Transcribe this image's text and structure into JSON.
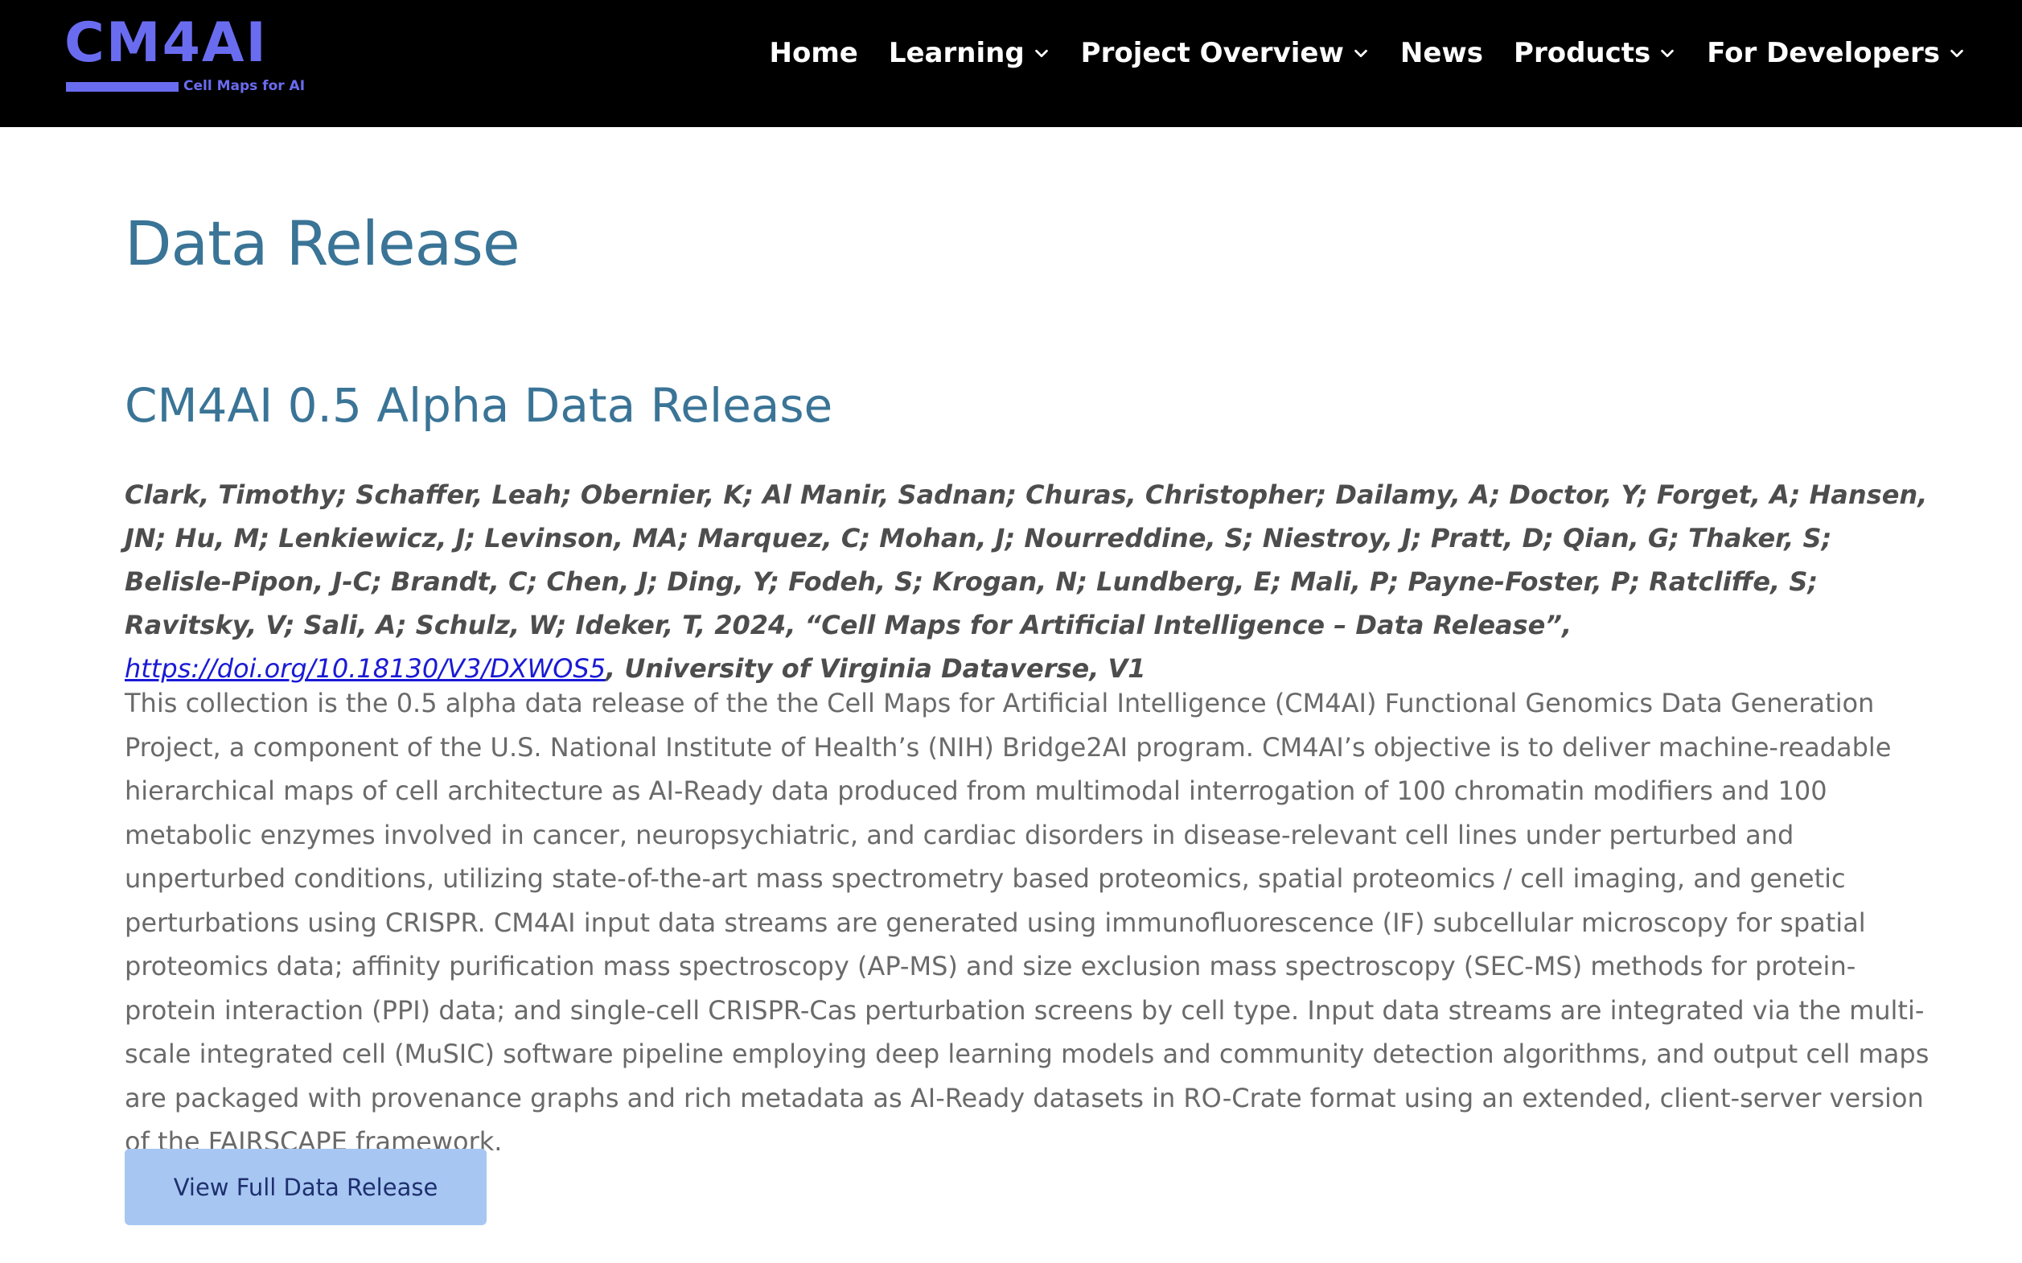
{
  "header": {
    "logo_text": "CM4AI",
    "logo_subtitle": "Cell Maps for AI",
    "brand_color": "#6a6cf0",
    "nav": [
      {
        "label": "Home",
        "has_dropdown": false
      },
      {
        "label": "Learning",
        "has_dropdown": true
      },
      {
        "label": "Project Overview",
        "has_dropdown": true
      },
      {
        "label": "News",
        "has_dropdown": false
      },
      {
        "label": "Products",
        "has_dropdown": true
      },
      {
        "label": "For Developers",
        "has_dropdown": true
      }
    ]
  },
  "main": {
    "page_title": "Data Release",
    "section_title": "CM4AI 0.5 Alpha Data Release",
    "citation": {
      "authors_text": "Clark, Timothy; Schaffer, Leah; Obernier, K; Al Manir, Sadnan; Churas, Christopher; Dailamy, A; Doctor, Y; Forget, A; Hansen, JN; Hu, M; Lenkiewicz, J; Levinson, MA; Marquez, C; Mohan, J; Nourreddine, S; Niestroy, J; Pratt, D; Qian, G; Thaker, S; Belisle-Pipon, J-C; Brandt, C; Chen, J; Ding, Y; Fodeh, S; Krogan, N; Lundberg, E; Mali, P; Payne-Foster, P; Ratcliffe, S; Ravitsky, V; Sali, A; Schulz, W; Ideker, T, 2024, “Cell Maps for Artificial Intelligence – Data Release”, ",
      "doi_link": "https://doi.org/10.18130/V3/DXWOS5",
      "suffix": ", University of Virginia Dataverse, V1"
    },
    "description": "This collection is the 0.5 alpha data release of the the Cell Maps for Artificial Intelligence (CM4AI) Functional Genomics Data Generation Project, a component of the U.S. National Institute of Health’s (NIH) Bridge2AI program. CM4AI’s objective is to deliver machine-readable hierarchical maps of cell architecture as AI-Ready data produced from multimodal interrogation of 100 chromatin modifiers and 100 metabolic enzymes involved in cancer, neuropsychiatric, and cardiac disorders in disease-relevant cell lines under perturbed and unperturbed conditions, utilizing state-of-the-art mass spectrometry based proteomics, spatial proteomics / cell imaging, and genetic perturbations using CRISPR. CM4AI input data streams are generated using immunofluorescence (IF) subcellular microscopy for spatial proteomics data; affinity purification mass spectroscopy (AP-MS) and size exclusion mass spectroscopy (SEC-MS) methods for protein-protein interaction (PPI) data; and single-cell CRISPR-Cas perturbation screens by cell type. Input data streams are integrated via the multi-scale integrated cell (MuSIC) software pipeline employing deep learning models and community detection algorithms, and output cell maps are packaged with provenance graphs and rich metadata as AI-Ready datasets in RO-Crate format using an extended, client-server version of the FAIRSCAPE framework.",
    "cta_label": "View Full Data Release"
  },
  "colors": {
    "header_bg": "#000000",
    "title": "#3a7496",
    "link": "#1a1ad6",
    "button_bg": "#a7c7f2",
    "button_text": "#1f2f6e"
  }
}
